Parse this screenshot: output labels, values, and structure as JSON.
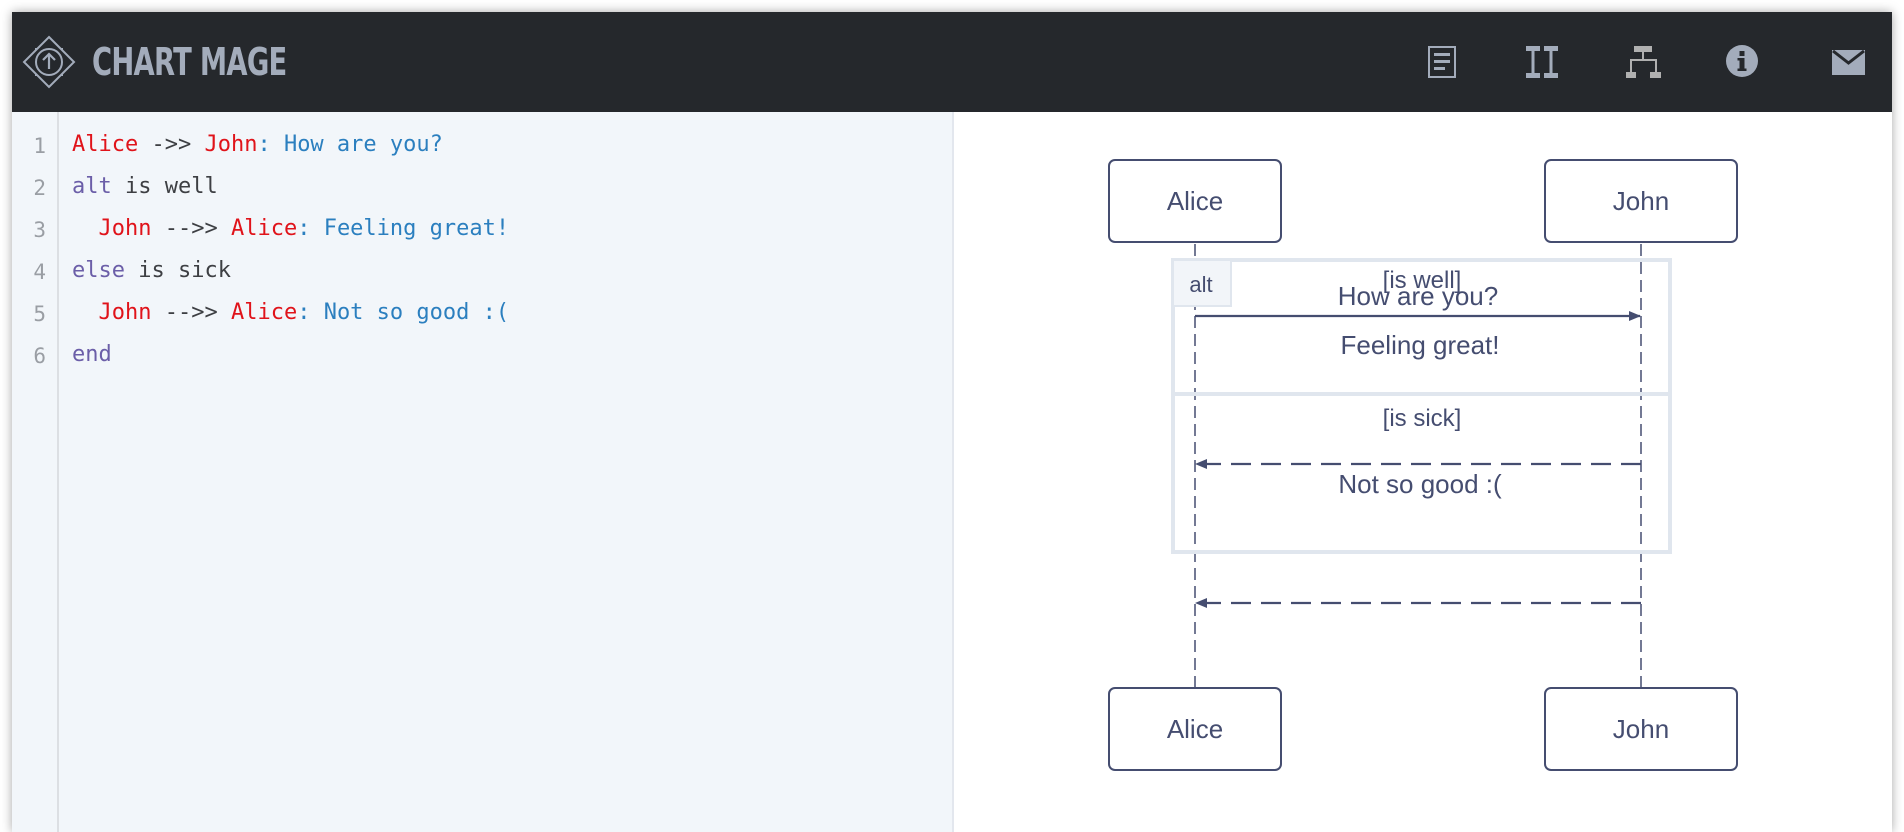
{
  "app": {
    "title": "CHART MAGE",
    "toolbar": [
      {
        "icon": "document-icon",
        "label": "Document"
      },
      {
        "icon": "text-cursor-icon",
        "label": "Editor"
      },
      {
        "icon": "sitemap-icon",
        "label": "Diagram"
      },
      {
        "icon": "info-icon",
        "label": "Info"
      },
      {
        "icon": "mail-icon",
        "label": "Contact"
      }
    ],
    "colors": {
      "header_bg": "#25282c",
      "header_fg": "#a3acbb",
      "editor_bg": "#f2f6fa",
      "actor_color": "#e0131a",
      "message_color": "#2b7fbf",
      "keyword_color": "#6b5ea8",
      "diagram_stroke": "#454d70",
      "frame_stroke": "#e0e6ee"
    }
  },
  "editor": {
    "lines": [
      {
        "number": "1",
        "tokens": [
          {
            "type": "actor",
            "text": "Alice"
          },
          {
            "type": "arrow",
            "text": " ->> "
          },
          {
            "type": "actor",
            "text": "John"
          },
          {
            "type": "msg",
            "text": ": How are you?"
          }
        ]
      },
      {
        "number": "2",
        "tokens": [
          {
            "type": "kw",
            "text": "alt"
          },
          {
            "type": "txt",
            "text": " is well"
          }
        ]
      },
      {
        "number": "3",
        "tokens": [
          {
            "type": "txt",
            "text": "  "
          },
          {
            "type": "actor",
            "text": "John"
          },
          {
            "type": "arrow",
            "text": " -->> "
          },
          {
            "type": "actor",
            "text": "Alice"
          },
          {
            "type": "msg",
            "text": ": Feeling great!"
          }
        ]
      },
      {
        "number": "4",
        "tokens": [
          {
            "type": "kw",
            "text": "else"
          },
          {
            "type": "txt",
            "text": " is sick"
          }
        ]
      },
      {
        "number": "5",
        "tokens": [
          {
            "type": "txt",
            "text": "  "
          },
          {
            "type": "actor",
            "text": "John"
          },
          {
            "type": "arrow",
            "text": " -->> "
          },
          {
            "type": "actor",
            "text": "Alice"
          },
          {
            "type": "msg",
            "text": ": Not so good :("
          }
        ]
      },
      {
        "number": "6",
        "tokens": [
          {
            "type": "kw",
            "text": "end"
          }
        ]
      }
    ]
  },
  "diagram": {
    "actors": {
      "left": "Alice",
      "right": "John"
    },
    "messages": [
      {
        "from": "Alice",
        "to": "John",
        "text": "How are you?",
        "style": "solid"
      },
      {
        "from": "John",
        "to": "Alice",
        "text": "Feeling great!",
        "style": "dashed"
      },
      {
        "from": "John",
        "to": "Alice",
        "text": "Not so good :(",
        "style": "dashed"
      }
    ],
    "alt": {
      "label": "alt",
      "conditions": [
        "[is well]",
        "[is sick]"
      ]
    }
  }
}
